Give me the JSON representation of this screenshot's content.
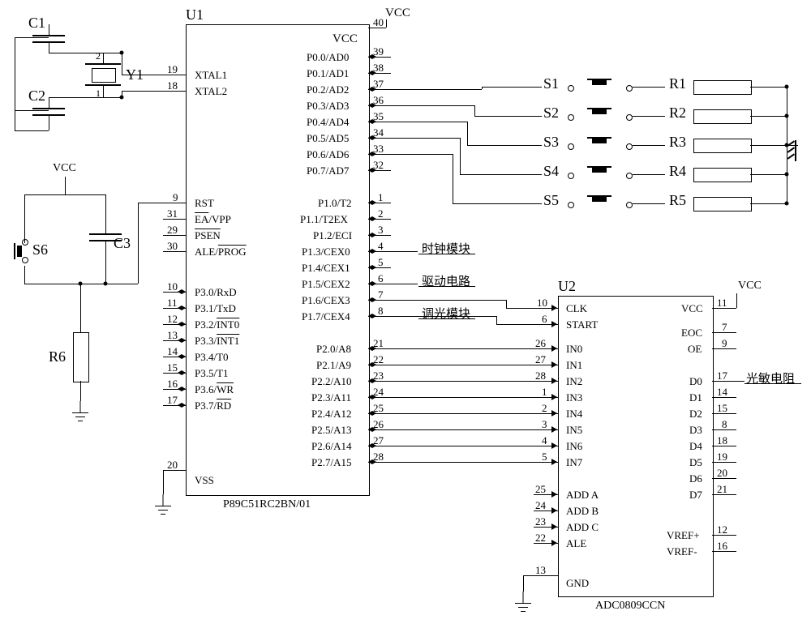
{
  "refs": {
    "U1": "U1",
    "U2": "U2",
    "C1": "C1",
    "C2": "C2",
    "C3": "C3",
    "Y1": "Y1",
    "S1": "S1",
    "S2": "S2",
    "S3": "S3",
    "S4": "S4",
    "S5": "S5",
    "S6": "S6",
    "R1": "R1",
    "R2": "R2",
    "R3": "R3",
    "R4": "R4",
    "R5": "R5",
    "R6": "R6"
  },
  "nets": {
    "VCC": "VCC"
  },
  "u1": {
    "part": "P89C51RC2BN/01",
    "vcc_pin": "40",
    "vcc_label": "VCC",
    "xtal1": {
      "num": "19",
      "label": "XTAL1"
    },
    "xtal2": {
      "num": "18",
      "label": "XTAL2"
    },
    "rst": {
      "num": "9",
      "label": "RST"
    },
    "ea": {
      "num": "31",
      "label": "EA/VPP",
      "over": "EA"
    },
    "psen": {
      "num": "29",
      "label": "PSEN",
      "over": "PSEN"
    },
    "ale": {
      "num": "30",
      "label": "ALE/PROG",
      "over": "PROG"
    },
    "p3": [
      {
        "num": "10",
        "label": "P3.0/RxD"
      },
      {
        "num": "11",
        "label": "P3.1/TxD"
      },
      {
        "num": "12",
        "label": "P3.2/INT0",
        "over": "INT0"
      },
      {
        "num": "13",
        "label": "P3.3/INT1",
        "over": "INT1"
      },
      {
        "num": "14",
        "label": "P3.4/T0"
      },
      {
        "num": "15",
        "label": "P3.5/T1"
      },
      {
        "num": "16",
        "label": "P3.6/WR",
        "over": "WR"
      },
      {
        "num": "17",
        "label": "P3.7/RD",
        "over": "RD"
      }
    ],
    "vss": {
      "num": "20",
      "label": "VSS"
    },
    "p0": [
      {
        "num": "39",
        "label": "P0.0/AD0"
      },
      {
        "num": "38",
        "label": "P0.1/AD1"
      },
      {
        "num": "37",
        "label": "P0.2/AD2"
      },
      {
        "num": "36",
        "label": "P0.3/AD3"
      },
      {
        "num": "35",
        "label": "P0.4/AD4"
      },
      {
        "num": "34",
        "label": "P0.5/AD5"
      },
      {
        "num": "33",
        "label": "P0.6/AD6"
      },
      {
        "num": "32",
        "label": "P0.7/AD7"
      }
    ],
    "p1": [
      {
        "num": "1",
        "label": "P1.0/T2"
      },
      {
        "num": "2",
        "label": "P1.1/T2EX"
      },
      {
        "num": "3",
        "label": "P1.2/ECI"
      },
      {
        "num": "4",
        "label": "P1.3/CEX0"
      },
      {
        "num": "5",
        "label": "P1.4/CEX1"
      },
      {
        "num": "6",
        "label": "P1.5/CEX2"
      },
      {
        "num": "7",
        "label": "P1.6/CEX3"
      },
      {
        "num": "8",
        "label": "P1.7/CEX4"
      }
    ],
    "p2": [
      {
        "num": "21",
        "label": "P2.0/A8"
      },
      {
        "num": "22",
        "label": "P2.1/A9"
      },
      {
        "num": "23",
        "label": "P2.2/A10"
      },
      {
        "num": "24",
        "label": "P2.3/A11"
      },
      {
        "num": "25",
        "label": "P2.4/A12"
      },
      {
        "num": "26",
        "label": "P2.5/A13"
      },
      {
        "num": "27",
        "label": "P2.6/A14"
      },
      {
        "num": "28",
        "label": "P2.7/A15"
      }
    ]
  },
  "u2": {
    "part": "ADC0809CCN",
    "clk": {
      "num": "10",
      "label": "CLK"
    },
    "start": {
      "num": "6",
      "label": "START"
    },
    "in": [
      {
        "num": "26",
        "label": "IN0"
      },
      {
        "num": "27",
        "label": "IN1"
      },
      {
        "num": "28",
        "label": "IN2"
      },
      {
        "num": "1",
        "label": "IN3"
      },
      {
        "num": "2",
        "label": "IN4"
      },
      {
        "num": "3",
        "label": "IN5"
      },
      {
        "num": "4",
        "label": "IN6"
      },
      {
        "num": "5",
        "label": "IN7"
      }
    ],
    "adda": {
      "num": "25",
      "label": "ADD A"
    },
    "addb": {
      "num": "24",
      "label": "ADD B"
    },
    "addc": {
      "num": "23",
      "label": "ADD C"
    },
    "ale": {
      "num": "22",
      "label": "ALE"
    },
    "gnd": {
      "num": "13",
      "label": "GND"
    },
    "vcc": {
      "num": "11",
      "label": "VCC"
    },
    "eoc": {
      "num": "7",
      "label": "EOC"
    },
    "oe": {
      "num": "9",
      "label": "OE"
    },
    "d": [
      {
        "num": "17",
        "label": "D0"
      },
      {
        "num": "14",
        "label": "D1"
      },
      {
        "num": "15",
        "label": "D2"
      },
      {
        "num": "8",
        "label": "D3"
      },
      {
        "num": "18",
        "label": "D4"
      },
      {
        "num": "19",
        "label": "D5"
      },
      {
        "num": "20",
        "label": "D6"
      },
      {
        "num": "21",
        "label": "D7"
      }
    ],
    "vrefp": {
      "num": "12",
      "label": "VREF+"
    },
    "vrefm": {
      "num": "16",
      "label": "VREF-"
    }
  },
  "labels": {
    "clock_module": "时钟模块",
    "driver_circuit": "驱动电路",
    "dimming_module": "调光模块",
    "photoresistor": "光敏电阻",
    "y_top": "2",
    "y_bot": "1"
  }
}
